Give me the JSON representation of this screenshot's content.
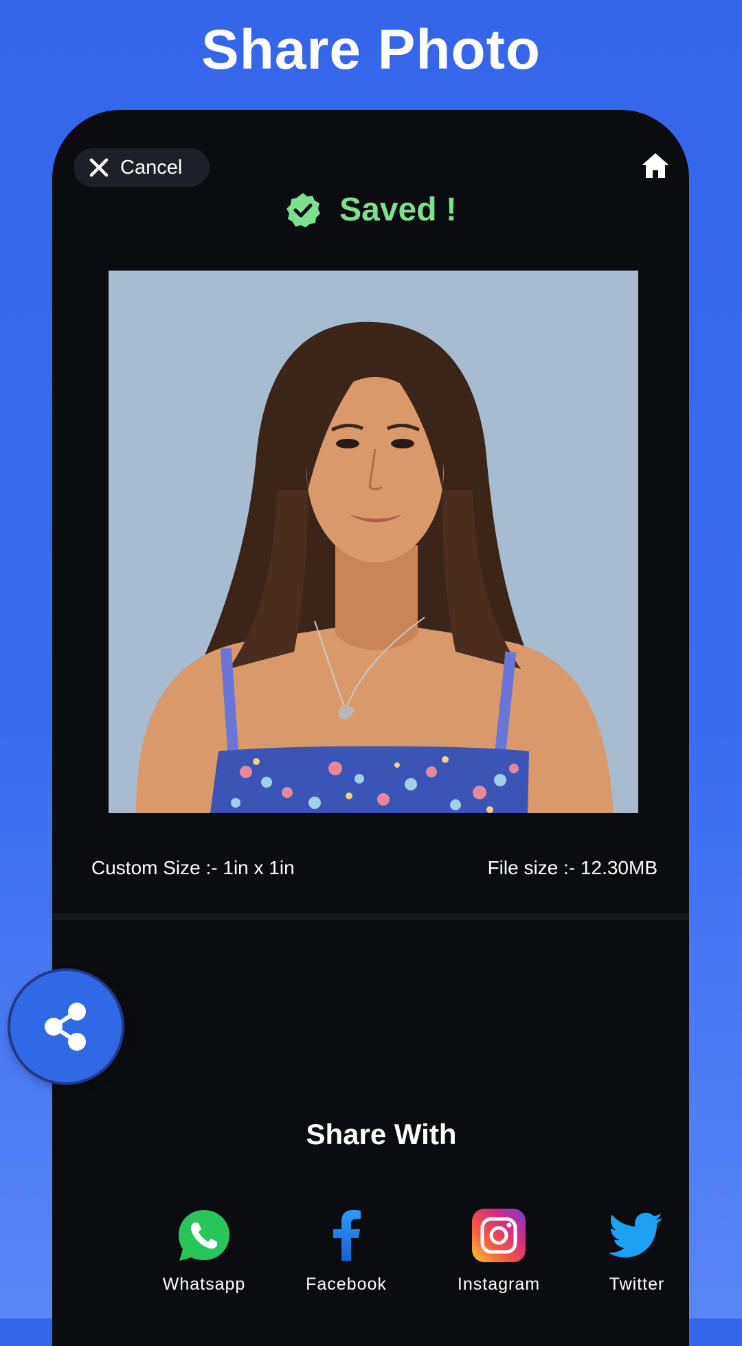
{
  "header": {
    "title": "Share Photo"
  },
  "toolbar": {
    "cancel_label": "Cancel",
    "home_icon": "home-icon"
  },
  "status": {
    "saved_label": "Saved !",
    "color": "#7ee08f"
  },
  "photo": {
    "background": "#a8bcd0"
  },
  "info": {
    "custom_size": "Custom Size :- 1in x 1in",
    "file_size": "File size :- 12.30MB"
  },
  "share": {
    "title": "Share With",
    "items": [
      {
        "label": "Whatsapp",
        "icon": "whatsapp-icon"
      },
      {
        "label": "Facebook",
        "icon": "facebook-icon"
      },
      {
        "label": "Instagram",
        "icon": "instagram-icon"
      },
      {
        "label": "Twitter",
        "icon": "twitter-icon"
      }
    ]
  },
  "fab": {
    "icon": "share-icon",
    "color": "#3068e6"
  }
}
